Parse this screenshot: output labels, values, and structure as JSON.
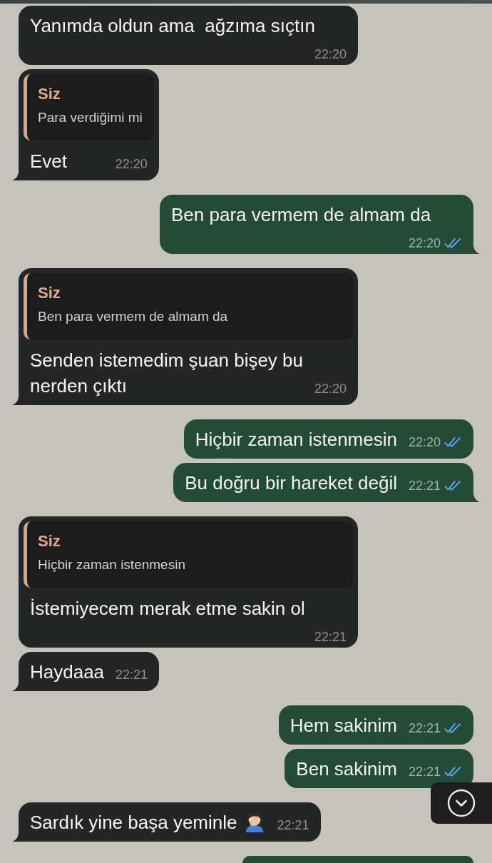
{
  "chat": {
    "messages": [
      {
        "kind": "incoming",
        "text": "Yanımda oldun ama  ağzıma sıçtın",
        "time": "22:20",
        "tail": false
      },
      {
        "kind": "incoming",
        "quote": {
          "author": "Siz",
          "text": "Para verdiğimi mi"
        },
        "text": "Evet",
        "time": "22:20",
        "tail": true
      },
      {
        "kind": "outgoing",
        "text": "Ben para vermem de almam da",
        "time": "22:20",
        "read": true,
        "tail": true
      },
      {
        "kind": "incoming",
        "quote": {
          "author": "Siz",
          "text": "Ben para vermem de almam da"
        },
        "text": "Senden istemedim şuan bişey bu nerden çıktı",
        "time": "22:20",
        "tail": true
      },
      {
        "kind": "outgoing",
        "text": "Hiçbir zaman istenmesin",
        "time": "22:20",
        "read": true,
        "tail": false
      },
      {
        "kind": "outgoing",
        "text": "Bu doğru bir hareket değil",
        "time": "22:21",
        "read": true,
        "tail": true
      },
      {
        "kind": "incoming",
        "quote": {
          "author": "Siz",
          "text": "Hiçbir zaman istenmesin"
        },
        "text": "İstemiyecem merak etme sakin ol",
        "time": "22:21",
        "tail": false
      },
      {
        "kind": "incoming",
        "text": "Haydaaa",
        "time": "22:21",
        "tail": true
      },
      {
        "kind": "outgoing",
        "text": "Hem sakinim",
        "time": "22:21",
        "read": true,
        "tail": false
      },
      {
        "kind": "outgoing",
        "text": "Ben sakinim",
        "time": "22:21",
        "read": true,
        "tail": false
      },
      {
        "kind": "incoming",
        "text": "Sardık yine başa yeminle",
        "emoji": true,
        "time": "22:21",
        "tail": true
      },
      {
        "kind": "outgoing",
        "clipped": true
      }
    ]
  }
}
